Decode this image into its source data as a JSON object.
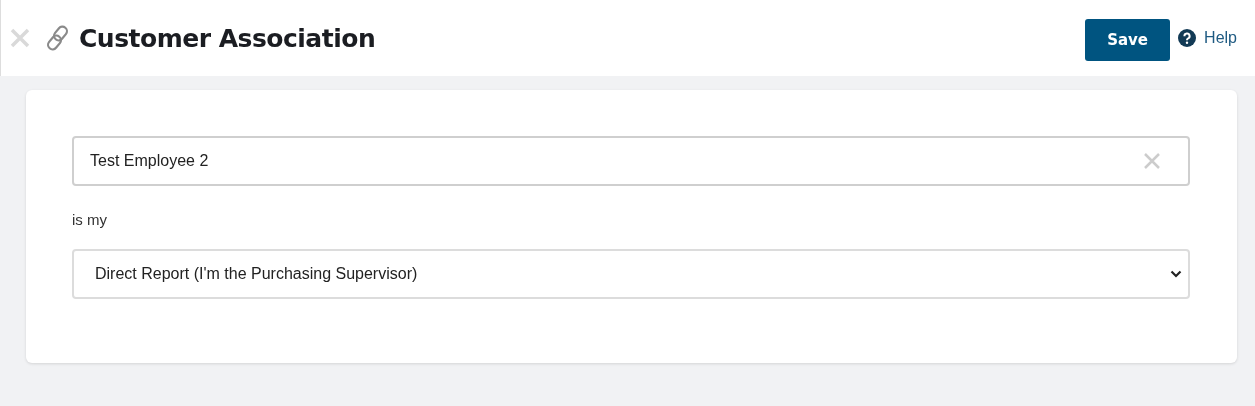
{
  "header": {
    "title": "Customer Association",
    "save_label": "Save",
    "help_label": "Help"
  },
  "form": {
    "customer_field": {
      "value": "Test Employee 2"
    },
    "relation_label": "is my",
    "relation_select": {
      "value": "Direct Report (I'm the Purchasing Supervisor)"
    }
  }
}
